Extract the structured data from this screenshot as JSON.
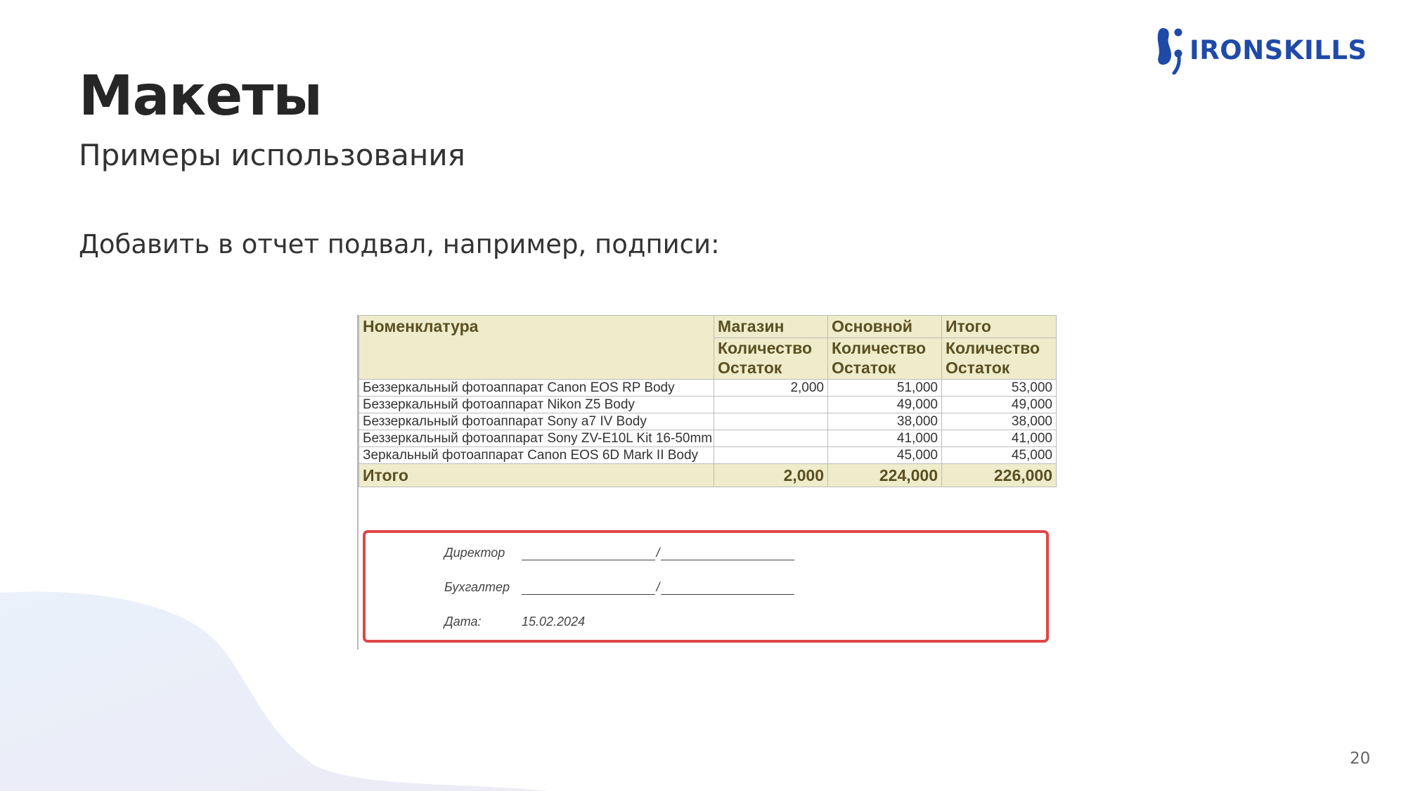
{
  "brand": {
    "name": "IRONSKILLS",
    "color": "#1f4aa8",
    "icon": "ironskills-logo-icon"
  },
  "slide": {
    "title": "Макеты",
    "subtitle": "Примеры использования",
    "body": "Добавить в отчет подвал, например, подписи:",
    "page_number": "20"
  },
  "report": {
    "header_row1": [
      "Номенклатура",
      "Магазин",
      "Основной",
      "Итого"
    ],
    "header_row2": [
      "Количество",
      "Количество",
      "Количество"
    ],
    "header_row3": [
      "Остаток",
      "Остаток",
      "Остаток"
    ],
    "rows": [
      {
        "item": "Беззеркальный фотоаппарат Canon EOS RP Body",
        "shop": "2,000",
        "main": "51,000",
        "total": "53,000"
      },
      {
        "item": "Беззеркальный фотоаппарат Nikon Z5 Body",
        "shop": "",
        "main": "49,000",
        "total": "49,000"
      },
      {
        "item": "Беззеркальный фотоаппарат Sony a7 IV Body",
        "shop": "",
        "main": "38,000",
        "total": "38,000"
      },
      {
        "item": "Беззеркальный фотоаппарат Sony ZV-E10L Kit 16-50mm",
        "shop": "",
        "main": "41,000",
        "total": "41,000"
      },
      {
        "item": "Зеркальный фотоаппарат Canon EOS 6D Mark II Body",
        "shop": "",
        "main": "45,000",
        "total": "45,000"
      }
    ],
    "totals": {
      "label": "Итого",
      "shop": "2,000",
      "main": "224,000",
      "total": "226,000"
    },
    "header_bg": "#eeeccb",
    "highlight_border": "#e04646"
  },
  "signatures": {
    "director_label": "Директор",
    "accountant_label": "Бухгалтер",
    "date_label": "Дата:",
    "date_value": "15.02.2024"
  }
}
